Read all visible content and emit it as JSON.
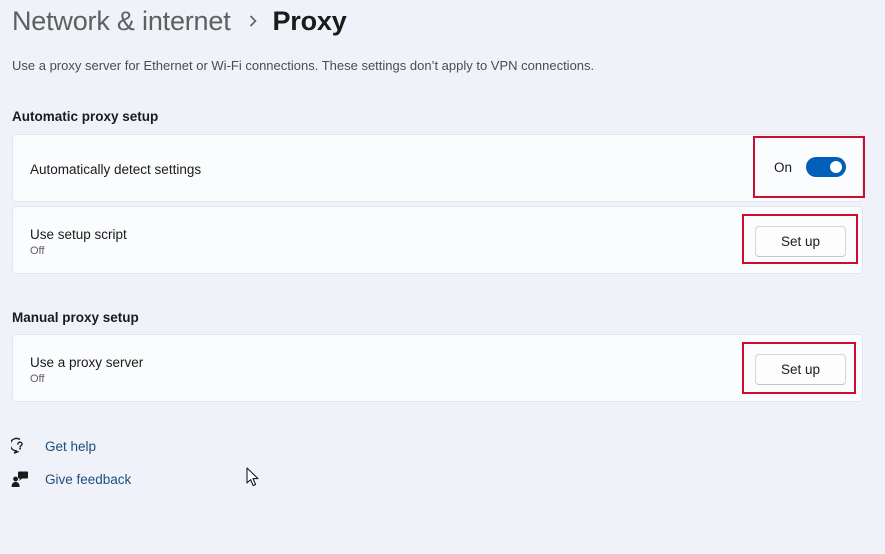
{
  "header": {
    "parent": "Network & internet",
    "current": "Proxy"
  },
  "description": "Use a proxy server for Ethernet or Wi-Fi connections. These settings don’t apply to VPN connections.",
  "automatic": {
    "heading": "Automatic proxy setup",
    "detect": {
      "title": "Automatically detect settings",
      "toggle_state": "On",
      "enabled": true
    },
    "script": {
      "title": "Use setup script",
      "status": "Off",
      "button": "Set up"
    }
  },
  "manual": {
    "heading": "Manual proxy setup",
    "proxy": {
      "title": "Use a proxy server",
      "status": "Off",
      "button": "Set up"
    }
  },
  "help": {
    "get_help": "Get help",
    "give_feedback": "Give feedback"
  },
  "colors": {
    "accent": "#005fb8",
    "highlight": "#c8102e",
    "link": "#1e4d7a"
  },
  "icons": {
    "separator": "chevron-right-icon",
    "get_help": "help-chat-icon",
    "feedback": "feedback-person-icon",
    "pointer": "mouse-cursor-icon"
  }
}
